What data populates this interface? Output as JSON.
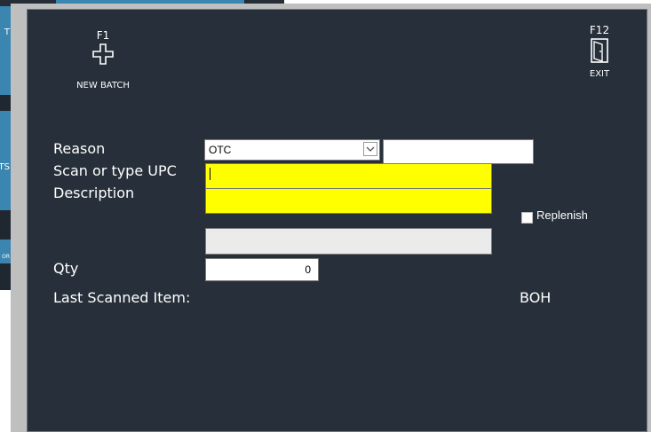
{
  "toolbar": {
    "new_batch": {
      "key": "F1",
      "label": "NEW BATCH",
      "icon": "plus-icon"
    },
    "exit": {
      "key": "F12",
      "label": "EXIT",
      "icon": "door-icon"
    }
  },
  "form": {
    "reason_label": "Reason",
    "reason_value": "OTC",
    "reason_extra_value": "",
    "upc_label": "Scan or type UPC",
    "upc_value": "",
    "description_label": "Description",
    "description_value": "",
    "secondary_value": "",
    "qty_label": "Qty",
    "qty_value": "0",
    "replenish_label": "Replenish",
    "replenish_checked": false,
    "last_scanned_label": "Last Scanned Item:",
    "boh_label": "BOH"
  },
  "background": {
    "tile_texts": [
      "T",
      "TS",
      "OR"
    ]
  },
  "colors": {
    "dialog_bg": "#27303a",
    "accent": "#3b85b1",
    "input_highlight": "#ffff00"
  }
}
